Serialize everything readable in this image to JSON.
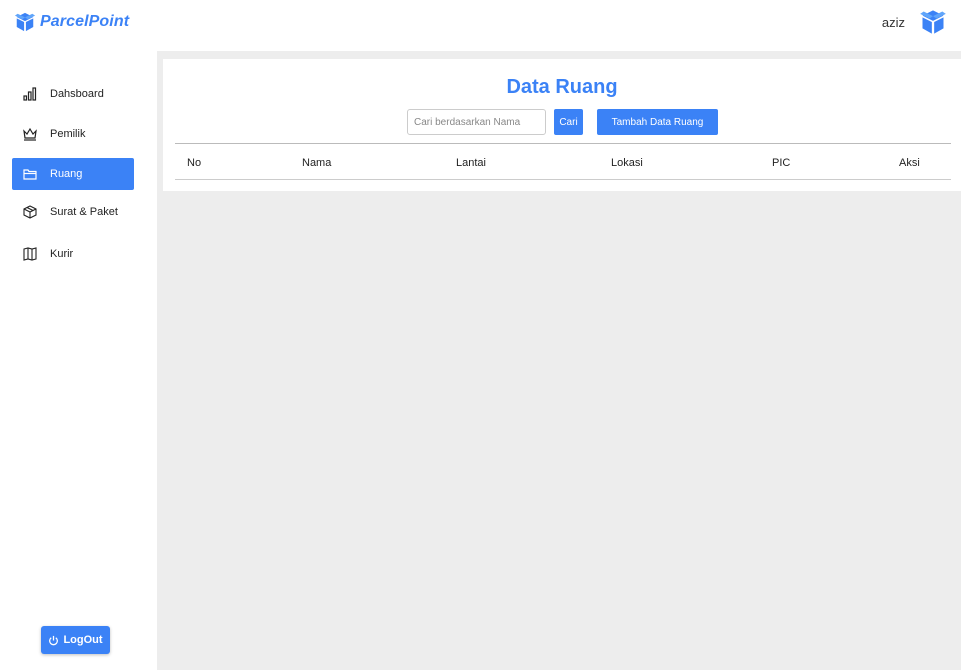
{
  "header": {
    "brand": "ParcelPoint",
    "username": "aziz",
    "brand_icon": "box-icon",
    "user_icon": "box-icon"
  },
  "sidebar": {
    "items": [
      {
        "label": "Dahsboard",
        "icon": "bar-chart-icon",
        "active": false
      },
      {
        "label": "Pemilik",
        "icon": "crown-icon",
        "active": false
      },
      {
        "label": "Ruang",
        "icon": "folder-icon",
        "active": true
      },
      {
        "label": "Surat & Paket",
        "icon": "package-icon",
        "active": false
      },
      {
        "label": "Kurir",
        "icon": "map-icon",
        "active": false
      }
    ],
    "logout_label": "LogOut"
  },
  "main": {
    "title": "Data Ruang",
    "search": {
      "placeholder": "Cari berdasarkan Nama",
      "value": ""
    },
    "search_button": "Cari",
    "add_button": "Tambah Data Ruang",
    "table": {
      "columns": [
        "No",
        "Nama",
        "Lantai",
        "Lokasi",
        "PIC",
        "Aksi"
      ],
      "rows": []
    }
  },
  "colors": {
    "accent": "#3b82f6",
    "content_bg": "#ededed"
  }
}
